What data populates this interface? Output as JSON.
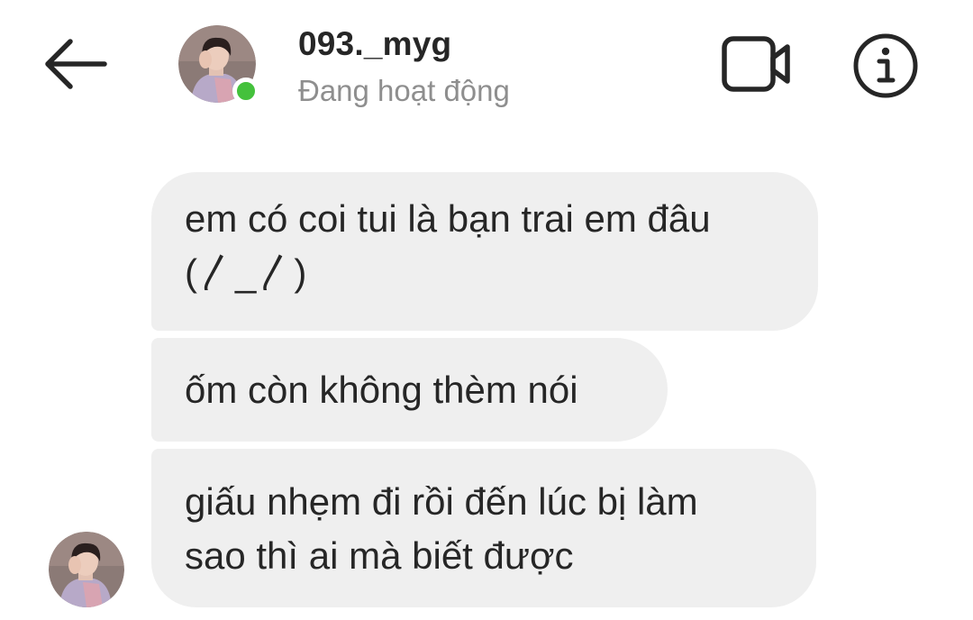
{
  "header": {
    "username": "093._myg",
    "status": "Đang hoạt động",
    "back_icon": "arrow-left-icon",
    "video_icon": "video-camera-icon",
    "info_icon": "info-circle-icon",
    "online_color": "#44c13c"
  },
  "messages": [
    {
      "sender": "093._myg",
      "text": "em có coi tui là bạn trai em đâu\n(〳_〳)"
    },
    {
      "sender": "093._myg",
      "text": "ốm còn không thèm nói"
    },
    {
      "sender": "093._myg",
      "text": "giấu nhẹm đi rồi đến lúc bị làm\nsao thì ai mà biết được"
    }
  ],
  "colors": {
    "bubble_bg": "#efefef",
    "text": "#262626",
    "muted": "#8e8e8e"
  }
}
